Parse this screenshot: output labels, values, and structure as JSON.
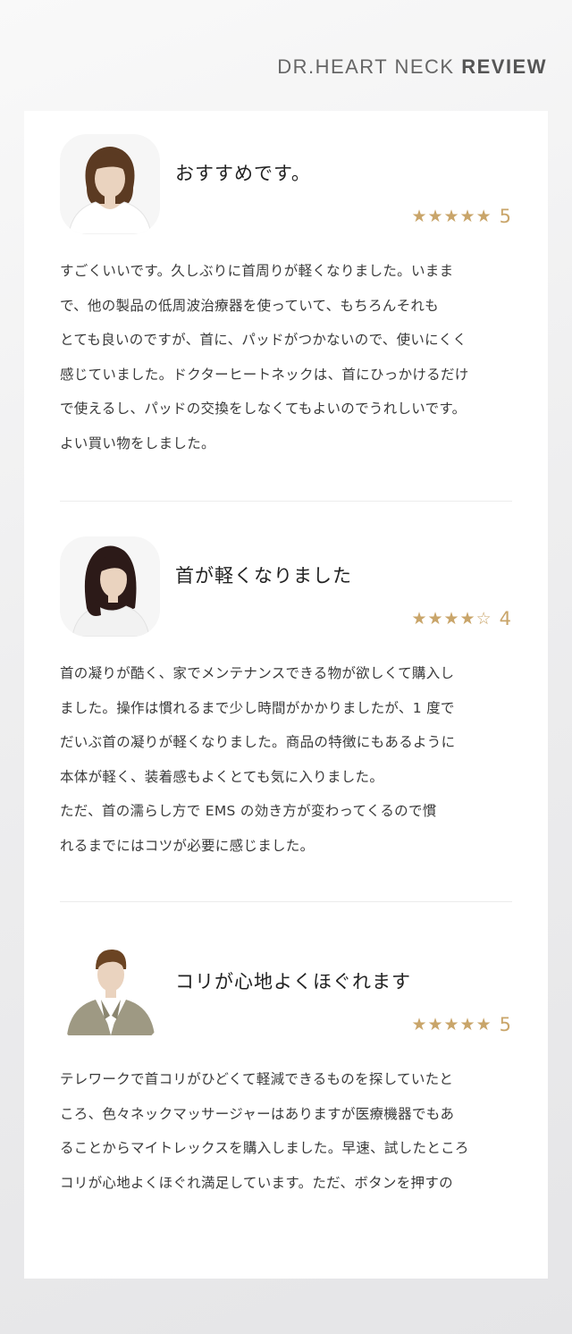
{
  "header": {
    "title_prefix": "DR.HEART NECK",
    "title_strong": "REVIEW"
  },
  "reviews": [
    {
      "avatar": "woman-short-hair-avatar",
      "title": "おすすめです。",
      "stars": "★★★★★",
      "rating": "5",
      "lines": [
        "すごくいいです。久しぶりに首周りが軽くなりました。いまま",
        "で、他の製品の低周波治療器を使っていて、もちろんそれも",
        "とても良いのですが、首に、パッドがつかないので、使いにくく",
        "感じていました。ドクターヒートネックは、首にひっかけるだけ",
        "で使えるし、パッドの交換をしなくてもよいのでうれしいです。",
        "よい買い物をしました。"
      ]
    },
    {
      "avatar": "woman-long-hair-avatar",
      "title": "首が軽くなりました",
      "stars": "★★★★☆",
      "rating": "4",
      "lines": [
        "首の凝りが酷く、家でメンテナンスできる物が欲しくて購入し",
        "ました。操作は慣れるまで少し時間がかかりましたが、1 度で",
        "だいぶ首の凝りが軽くなりました。商品の特徴にもあるように",
        "本体が軽く、装着感もよくとても気に入りました。",
        "ただ、首の濡らし方で EMS の効き方が変わってくるので慣",
        "れるまでにはコツが必要に感じました。"
      ]
    },
    {
      "avatar": "man-suit-avatar",
      "title": "コリが心地よくほぐれます",
      "stars": "★★★★★",
      "rating": "5",
      "lines": [
        "テレワークで首コリがひどくて軽減できるものを探していたと",
        "ころ、色々ネックマッサージャーはありますが医療機器でもあ",
        "ることからマイトレックスを購入しました。早速、試したところ",
        "コリが心地よくほぐれ満足しています。ただ、ボタンを押すの"
      ]
    }
  ],
  "colors": {
    "star": "#c9a56a",
    "text": "#3a3a3a",
    "card": "#ffffff"
  }
}
